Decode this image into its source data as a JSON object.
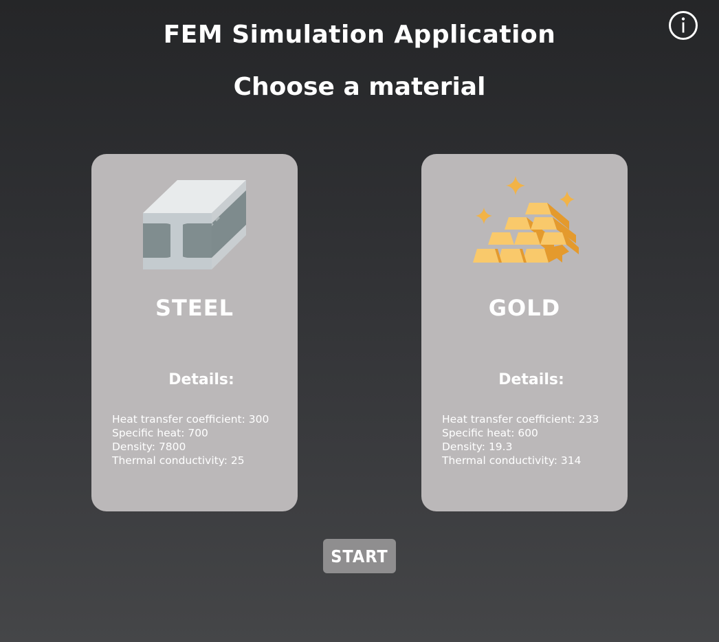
{
  "header": {
    "title": "FEM Simulation Application",
    "subtitle": "Choose a material",
    "info_icon": "info-circle-icon"
  },
  "materials": [
    {
      "name": "STEEL",
      "icon": "steel-i-beam-icon",
      "details_heading": "Details:",
      "details": [
        "Heat transfer coefficient: 300",
        "Specific heat: 700",
        "Density: 7800",
        "Thermal conductivity: 25"
      ]
    },
    {
      "name": "GOLD",
      "icon": "gold-bars-icon",
      "details_heading": "Details:",
      "details": [
        "Heat transfer coefficient: 233",
        "Specific heat: 600",
        "Density: 19.3",
        "Thermal conductivity: 314"
      ]
    }
  ],
  "actions": {
    "start_label": "START"
  },
  "colors": {
    "card_background": "#bbb8b9",
    "start_button": "#8f8e8f",
    "gold": "#f2b347",
    "steel": "#e4e7e8"
  }
}
